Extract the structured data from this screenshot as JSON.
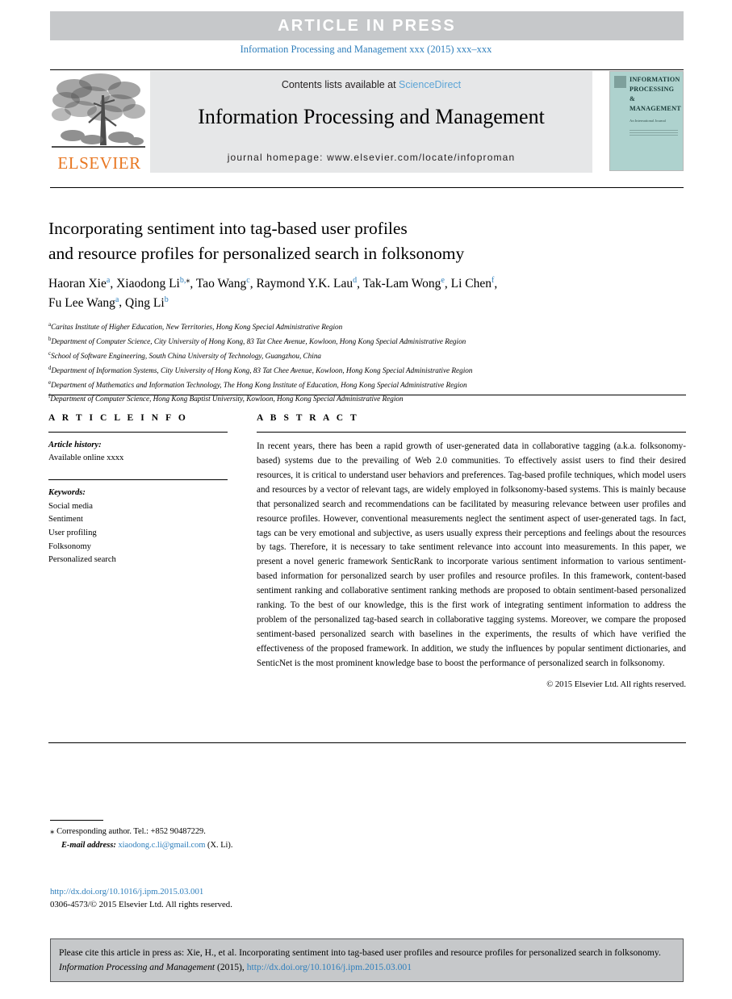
{
  "banner": {
    "text": "ARTICLE  IN  PRESS"
  },
  "journal_ref": "Information Processing and Management xxx (2015) xxx–xxx",
  "masthead": {
    "publisher_wordmark": "ELSEVIER",
    "contents_prefix": "Contents lists available at ",
    "contents_link": "ScienceDirect",
    "journal_name": "Information Processing and Management",
    "homepage": "journal homepage: www.elsevier.com/locate/infoproman",
    "cover": {
      "title": "INFORMATION PROCESSING & MANAGEMENT",
      "subtitle": "An International Journal"
    }
  },
  "article": {
    "title_line1": "Incorporating sentiment into tag-based user profiles",
    "title_line2": "and resource profiles for personalized search in folksonomy",
    "authors": [
      {
        "name": "Haoran Xie",
        "sup": "a"
      },
      {
        "name": "Xiaodong Li",
        "sup": "b,",
        "star": true
      },
      {
        "name": "Tao Wang",
        "sup": "c"
      },
      {
        "name": "Raymond Y.K. Lau",
        "sup": "d"
      },
      {
        "name": "Tak-Lam Wong",
        "sup": "e"
      },
      {
        "name": "Li Chen",
        "sup": "f"
      },
      {
        "name": "Fu Lee Wang",
        "sup": "a"
      },
      {
        "name": "Qing Li",
        "sup": "b"
      }
    ],
    "affiliations": [
      {
        "mark": "a",
        "text": "Caritas Institute of Higher Education, New Territories, Hong Kong Special Administrative Region"
      },
      {
        "mark": "b",
        "text": "Department of Computer Science, City University of Hong Kong, 83 Tat Chee Avenue, Kowloon, Hong Kong Special Administrative Region"
      },
      {
        "mark": "c",
        "text": "School of Software Engineering, South China University of Technology, Guangzhou, China"
      },
      {
        "mark": "d",
        "text": "Department of Information Systems, City University of Hong Kong, 83 Tat Chee Avenue, Kowloon, Hong Kong Special Administrative Region"
      },
      {
        "mark": "e",
        "text": "Department of Mathematics and Information Technology, The Hong Kong Institute of Education, Hong Kong Special Administrative Region"
      },
      {
        "mark": "f",
        "text": "Department of Computer Science, Hong Kong Baptist University, Kowloon, Hong Kong Special Administrative Region"
      }
    ]
  },
  "info": {
    "heading": "A R T I C L E   I N F O",
    "history_label": "Article history:",
    "history_value": "Available online xxxx",
    "keywords_label": "Keywords:",
    "keywords": [
      "Social media",
      "Sentiment",
      "User profiling",
      "Folksonomy",
      "Personalized search"
    ]
  },
  "abstract": {
    "heading": "A B S T R A C T",
    "body": "In recent years, there has been a rapid growth of user-generated data in collaborative tagging (a.k.a. folksonomy-based) systems due to the prevailing of Web 2.0 communities. To effectively assist users to find their desired resources, it is critical to understand user behaviors and preferences. Tag-based profile techniques, which model users and resources by a vector of relevant tags, are widely employed in folksonomy-based systems. This is mainly because that personalized search and recommendations can be facilitated by measuring relevance between user profiles and resource profiles. However, conventional measurements neglect the sentiment aspect of user-generated tags. In fact, tags can be very emotional and subjective, as users usually express their perceptions and feelings about the resources by tags. Therefore, it is necessary to take sentiment relevance into account into measurements. In this paper, we present a novel generic framework SenticRank to incorporate various sentiment information to various sentiment-based information for personalized search by user profiles and resource profiles. In this framework, content-based sentiment ranking and collaborative sentiment ranking methods are proposed to obtain sentiment-based personalized ranking. To the best of our knowledge, this is the first work of integrating sentiment information to address the problem of the personalized tag-based search in collaborative tagging systems. Moreover, we compare the proposed sentiment-based personalized search with baselines in the experiments, the results of which have verified the effectiveness of the proposed framework. In addition, we study the influences by popular sentiment dictionaries, and SenticNet is the most prominent knowledge base to boost the performance of personalized search in folksonomy.",
    "copyright": "© 2015 Elsevier Ltd. All rights reserved."
  },
  "footnote": {
    "star": "⁎",
    "corresponding": " Corresponding author. Tel.: +852 90487229.",
    "email_label": "E-mail address:",
    "email": "xiaodong.c.li@gmail.com",
    "email_suffix": " (X. Li).",
    "doi": "http://dx.doi.org/10.1016/j.ipm.2015.03.001",
    "issn": "0306-4573/© 2015 Elsevier Ltd. All rights reserved."
  },
  "cite_box": {
    "prefix": "Please cite this article in press as: Xie, H., et al. Incorporating sentiment into tag-based user profiles and resource profiles for personalized search in folksonomy. ",
    "journal": "Information Processing and Management",
    "year": " (2015), ",
    "doi": "http://dx.doi.org/10.1016/j.ipm.2015.03.001"
  },
  "colors": {
    "band_gray": "#c6c8ca",
    "box_gray": "#e6e7e8",
    "link_blue": "#2e7ebb",
    "sciencedirect_blue": "#5ba4d6",
    "elsevier_orange": "#e87722",
    "cover_teal": "#aed2ce"
  }
}
